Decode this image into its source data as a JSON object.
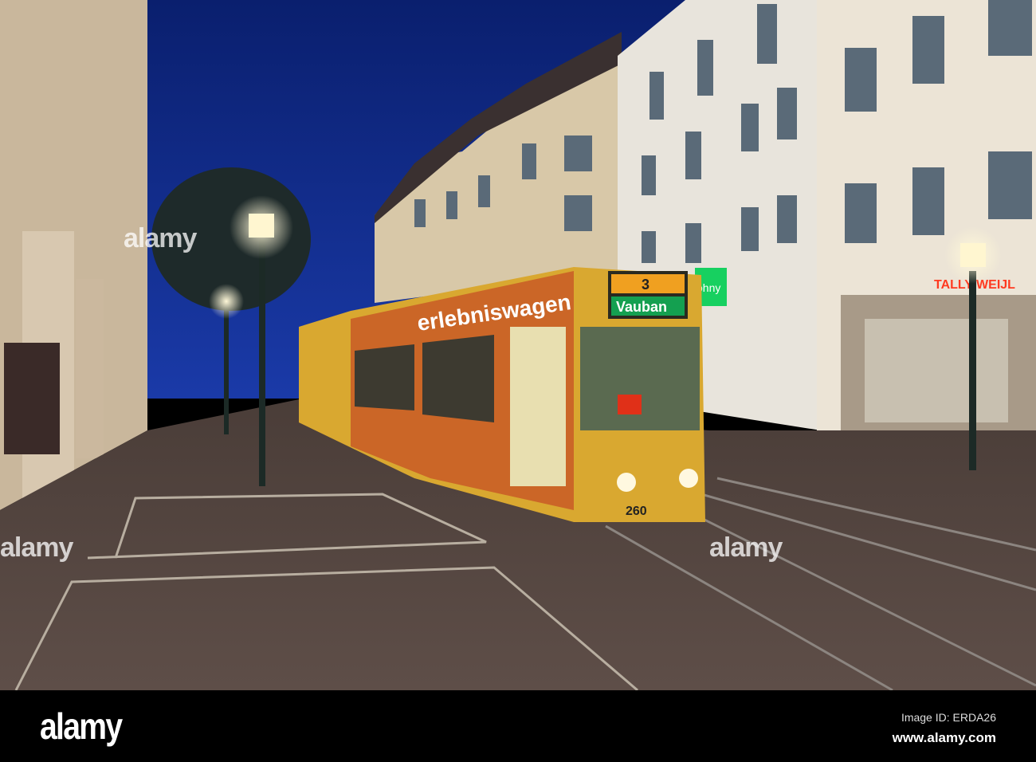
{
  "photo": {
    "tram": {
      "route_number": "3",
      "destination": "Vauban",
      "fleet_number": "260",
      "side_ad": "erlebniswagen",
      "color": "#d9a830"
    },
    "storefront_signs": [
      "ohny",
      "TALLY WEIJL"
    ],
    "sky_color": "#0f2a8a",
    "watermark_text": "alamy"
  },
  "footer": {
    "logo": "alamy",
    "image_id": "Image ID: ERDA26",
    "url": "www.alamy.com"
  }
}
